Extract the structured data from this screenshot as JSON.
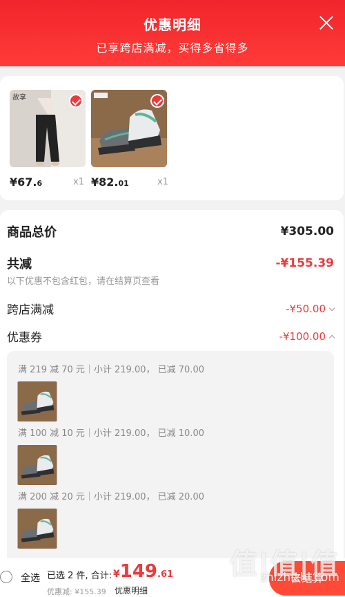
{
  "header": {
    "title": "优惠明细",
    "subtitle": "已享跨店满减，买得多省得多"
  },
  "products": [
    {
      "price_int": "¥67.",
      "price_dec": "6",
      "qty": "x1",
      "brand": "故享"
    },
    {
      "price_int": "¥82.",
      "price_dec": "01",
      "qty": "x1"
    }
  ],
  "summary": {
    "total_label": "商品总价",
    "total_value": "¥305.00",
    "reduce_label": "共减",
    "reduce_value": "-¥155.39",
    "note": "以下优惠不包含红包，请在结算页查看",
    "cross_label": "跨店满减",
    "cross_value": "-¥50.00",
    "coupon_label": "优惠券",
    "coupon_value": "-¥100.00"
  },
  "coupons": [
    {
      "text": "满 219 减 70 元｜小计 219.00，  已减 70.00"
    },
    {
      "text": "满 100 减 10 元｜小计 219.00，  已减 10.00"
    },
    {
      "text": "满 200 减 20 元｜小计 219.00，  已减 20.00"
    }
  ],
  "bottom": {
    "select_all": "全选",
    "selected": "已选 2 件, 合计:",
    "cur": "¥",
    "int": "149",
    "dec": ".61",
    "discount": "优惠减: ¥155.39",
    "detail_link": "优惠明细",
    "submit": "去结算"
  },
  "watermark": {
    "logo": "值|值|值",
    "site": "zhizhizhi.com"
  },
  "colors": {
    "primary": "#e93b3d",
    "header": "#f0252b"
  }
}
